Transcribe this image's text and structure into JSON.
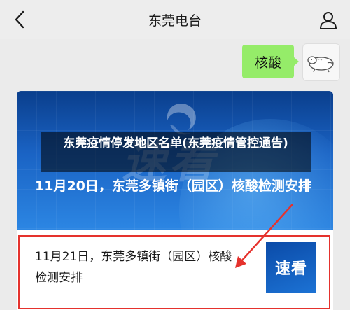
{
  "header": {
    "title": "东莞电台",
    "back_icon": "chevron-left-icon",
    "profile_icon": "person-icon"
  },
  "message": {
    "text": "核酸",
    "bubble_color": "#95ec69"
  },
  "article": {
    "overlay_title": "东莞疫情停发地区名单(东莞疫情管控通告)",
    "cover_brand": "速看",
    "cover_headline": "11月20日，东莞多镇街（园区）核酸检测安排",
    "sub_title": "11月21日，东莞多镇街（园区）核酸检测安排",
    "sub_thumb_text": "速看",
    "highlight_color": "#e5322d"
  }
}
